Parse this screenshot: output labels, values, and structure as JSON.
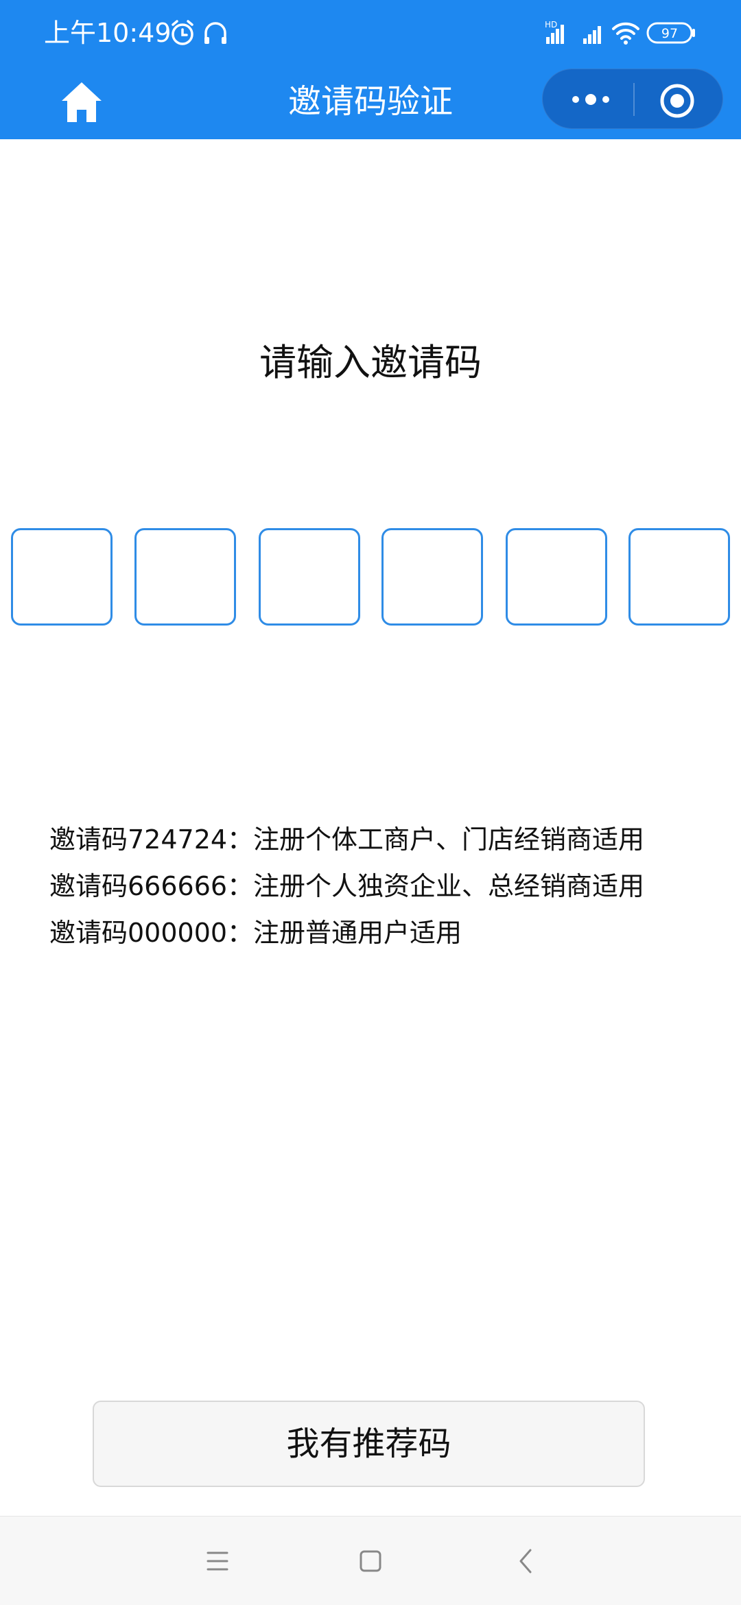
{
  "status_bar": {
    "time": "上午10:49",
    "battery": "97",
    "network_badge": "HD",
    "icons": [
      "alarm-icon",
      "headset-icon",
      "signal-icon",
      "wifi-icon",
      "battery-icon"
    ]
  },
  "nav": {
    "title": "邀请码验证",
    "home_icon": "home-icon",
    "more_icon": "more-dots-icon",
    "close_icon": "mini-program-close-icon"
  },
  "prompt": "请输入邀请码",
  "code_inputs": [
    "",
    "",
    "",
    "",
    "",
    ""
  ],
  "notes": [
    "邀请码724724：注册个体工商户、门店经销商适用",
    "邀请码666666：注册个人独资企业、总经销商适用",
    "邀请码000000：注册普通用户适用"
  ],
  "referral_button": "我有推荐码",
  "system_nav": [
    "menu-icon",
    "home-square-icon",
    "back-icon"
  ],
  "colors": {
    "header": "#1E88F0",
    "capsule": "#1467C7",
    "input_border": "#2F8CE6",
    "button_bg": "#F6F6F6"
  }
}
